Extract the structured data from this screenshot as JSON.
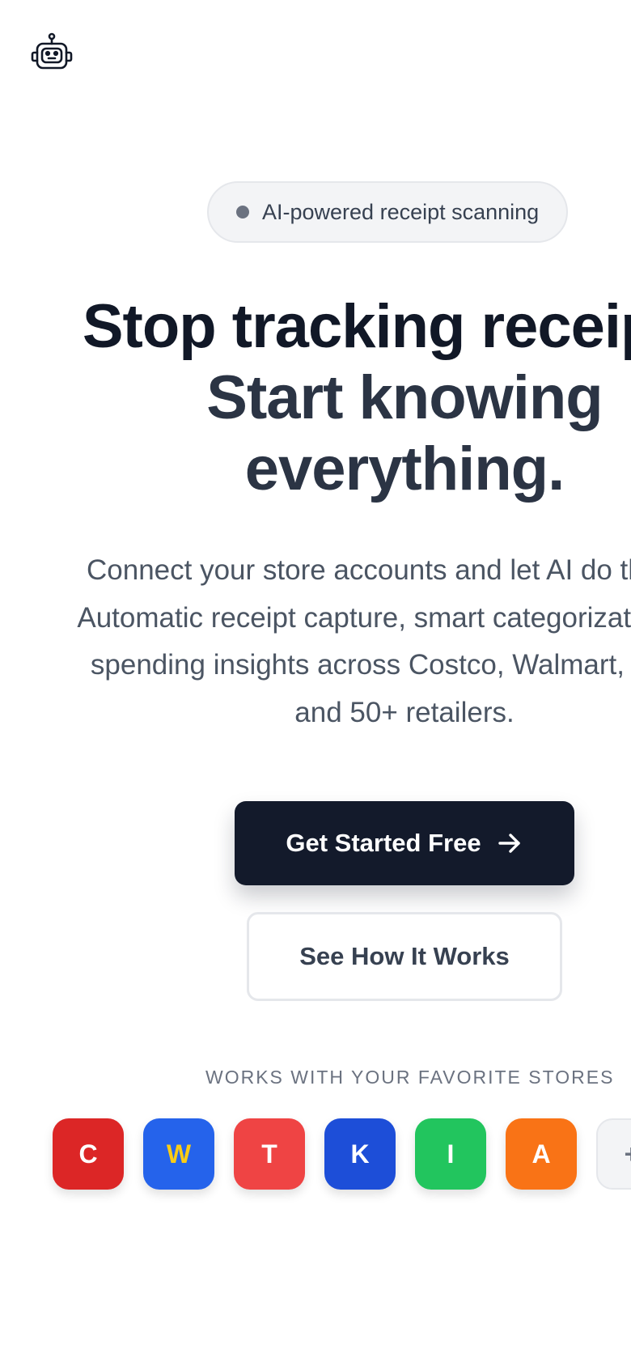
{
  "header": {
    "logo_icon": "robot-icon"
  },
  "hero": {
    "badge_text": "AI-powered receipt scanning",
    "headline": {
      "line1": "Stop tracking receipts.",
      "line2": "Start knowing",
      "line3": "everything."
    },
    "subheadline": {
      "line1": "Connect your store accounts and let AI do the rest.",
      "line2": "Automatic receipt capture, smart categorization, and",
      "line3": "spending insights across Costco, Walmart, Target,",
      "line4": "and 50+ retailers."
    },
    "primary_cta": {
      "label": "Get Started Free",
      "icon": "arrow-right-icon"
    },
    "secondary_cta": {
      "label": "See How It Works"
    }
  },
  "stores": {
    "label": "WORKS WITH YOUR FAVORITE STORES",
    "tiles": [
      {
        "letter": "C",
        "bg": "#dc2626",
        "fg": "#ffffff"
      },
      {
        "letter": "W",
        "bg": "#2563eb",
        "fg": "#facc15"
      },
      {
        "letter": "T",
        "bg": "#ef4444",
        "fg": "#ffffff"
      },
      {
        "letter": "K",
        "bg": "#1d4ed8",
        "fg": "#ffffff"
      },
      {
        "letter": "I",
        "bg": "#22c55e",
        "fg": "#ffffff"
      },
      {
        "letter": "A",
        "bg": "#f97316",
        "fg": "#ffffff"
      },
      {
        "letter": "+",
        "bg": "#f3f4f6",
        "fg": "#6b7280"
      }
    ]
  },
  "colors": {
    "primary_button": "#131a2b",
    "headline": "#111827",
    "body_text": "#4b5563"
  }
}
